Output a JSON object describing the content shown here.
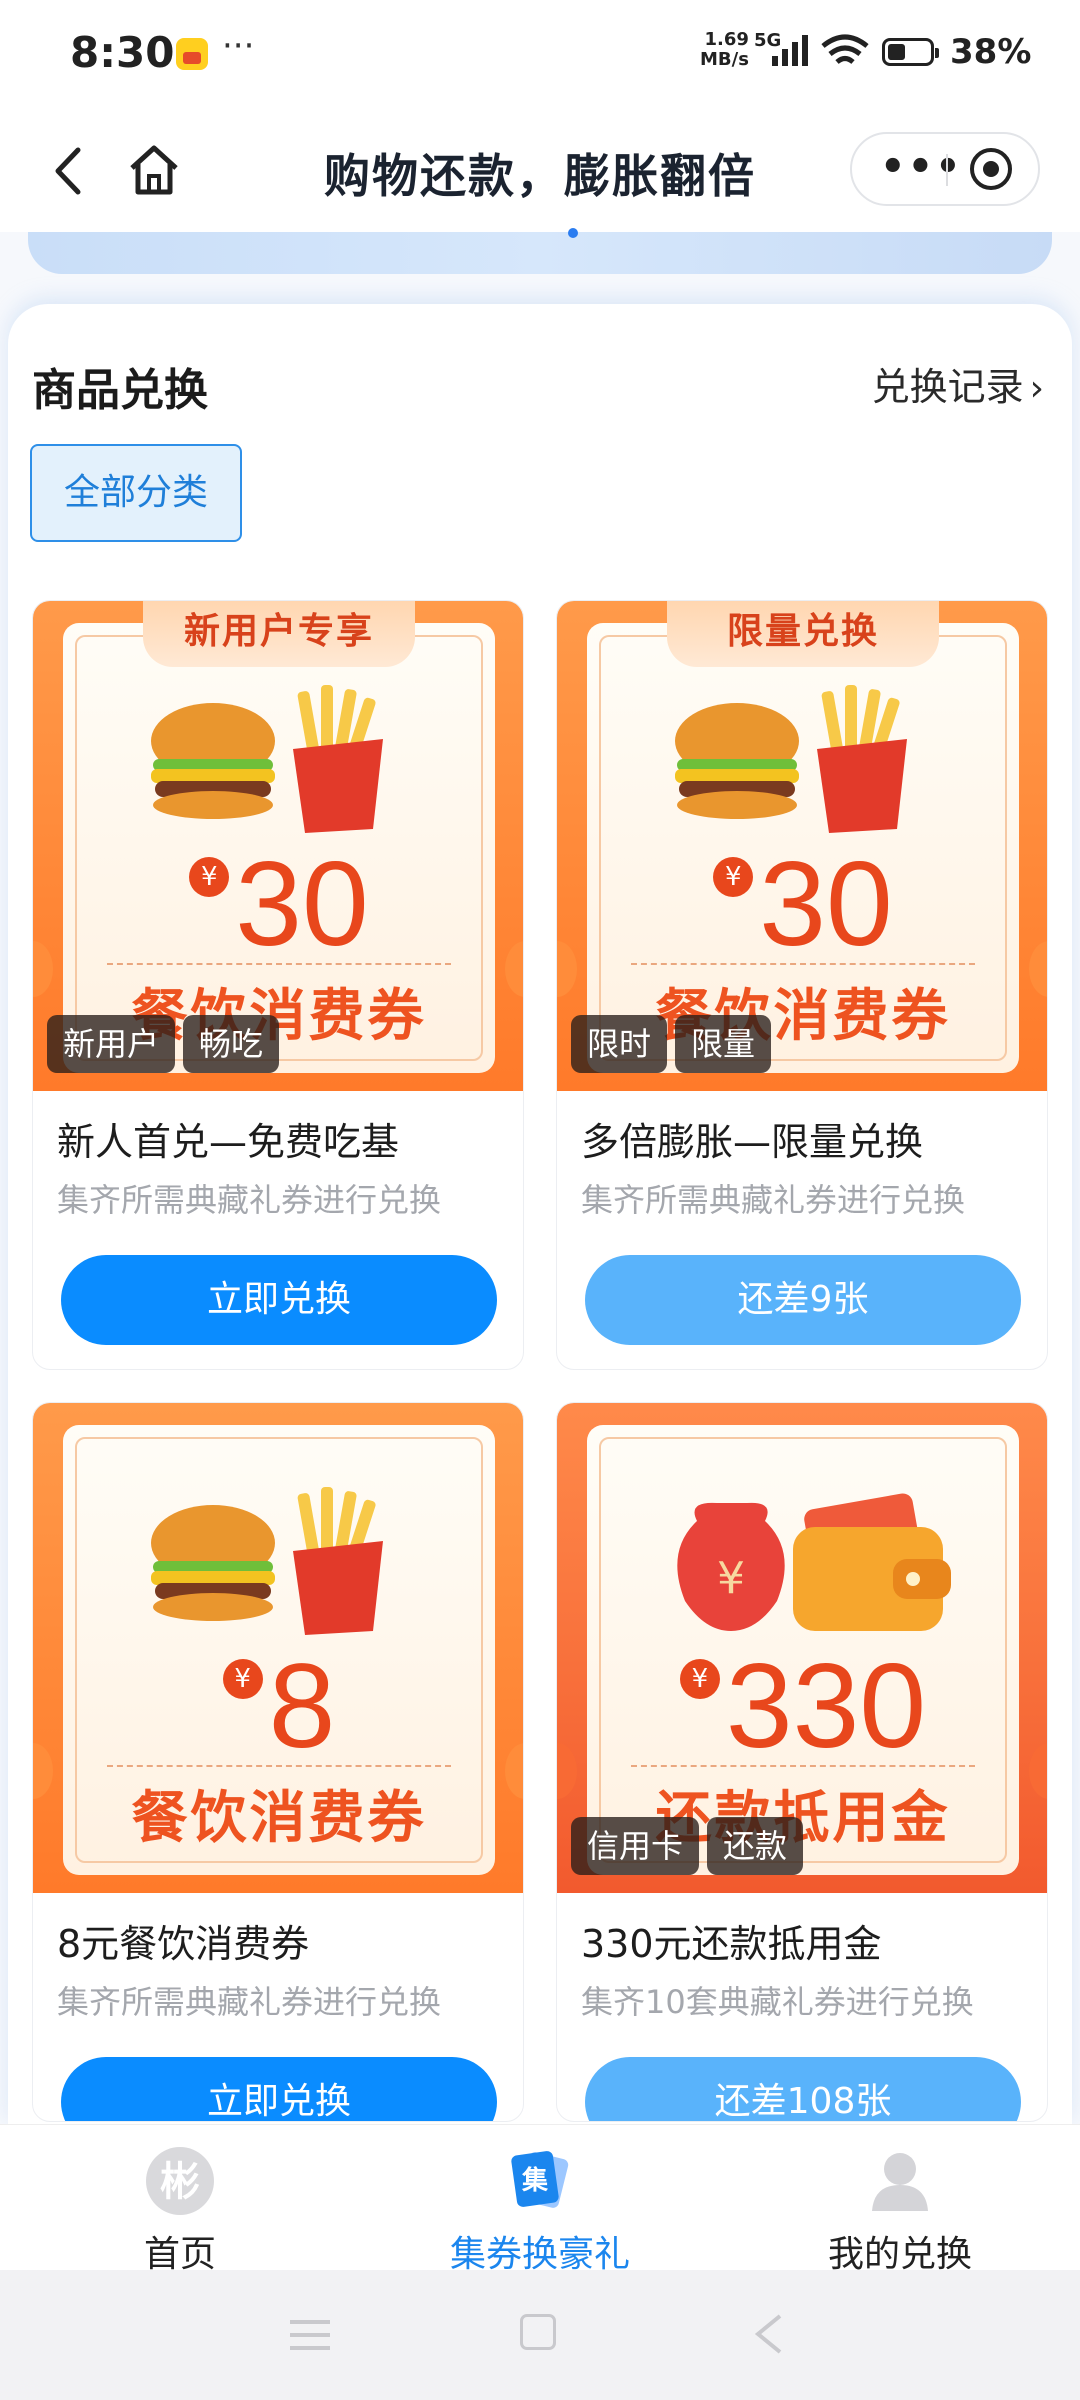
{
  "status_bar": {
    "time": "8:30",
    "more": "···",
    "net_speed_value": "1.69",
    "net_speed_unit": "MB/s",
    "network": "5G",
    "battery": "38%"
  },
  "nav": {
    "title": "购物还款，膨胀翻倍",
    "more": "•••"
  },
  "section": {
    "title": "商品兑换",
    "record_link": "兑换记录",
    "filter": "全部分类"
  },
  "cards": [
    {
      "ribbon": "新用户专享",
      "currency": "¥",
      "price": "30",
      "poster_sub": "餐饮消费券",
      "tags": [
        "新用户",
        "畅吃"
      ],
      "title": "新人首兑—免费吃基",
      "desc": "集齐所需典藏礼券进行兑换",
      "button": "立即兑换"
    },
    {
      "ribbon": "限量兑换",
      "currency": "¥",
      "price": "30",
      "poster_sub": "餐饮消费券",
      "tags": [
        "限时",
        "限量"
      ],
      "title": "多倍膨胀—限量兑换",
      "desc": "集齐所需典藏礼券进行兑换",
      "button": "还差9张"
    },
    {
      "currency": "¥",
      "price": "8",
      "poster_sub": "餐饮消费券",
      "title": "8元餐饮消费券",
      "desc": "集齐所需典藏礼券进行兑换",
      "button": "立即兑换"
    },
    {
      "currency": "¥",
      "price": "330",
      "poster_sub": "还款抵用金",
      "tags": [
        "信用卡",
        "还款"
      ],
      "title": "330元还款抵用金",
      "desc": "集齐10套典藏礼券进行兑换",
      "button": "还差108张"
    }
  ],
  "tabbar": [
    {
      "label": "首页",
      "icon": "home-logo-icon",
      "active": false
    },
    {
      "label": "集券换豪礼",
      "icon": "coupon-collect-icon",
      "active": true
    },
    {
      "label": "我的兑换",
      "icon": "user-icon",
      "active": false
    }
  ],
  "colors": {
    "primary_blue": "#0a8cff",
    "light_blue": "#59b3fb",
    "coupon_orange": "#ff7a2a",
    "price_red": "#e8471c"
  }
}
